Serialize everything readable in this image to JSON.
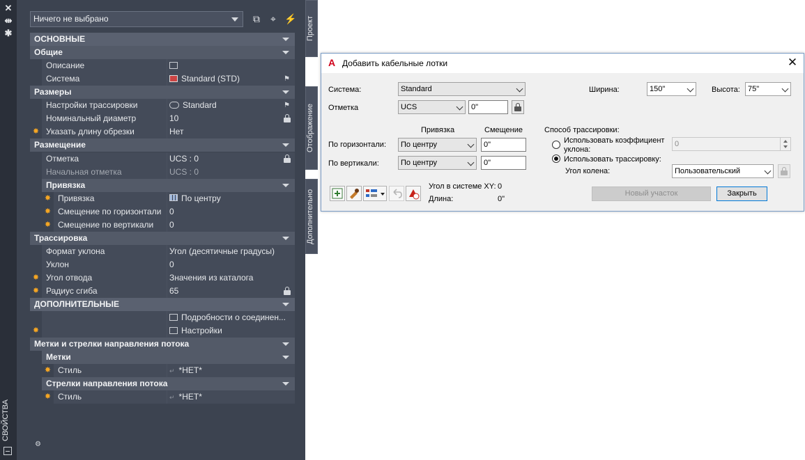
{
  "palette": {
    "title_vertical": "СВОЙСТВА",
    "selector_value": "Ничего не выбрано",
    "tabs": [
      "Проект",
      "Отображение",
      "Дополнительно"
    ],
    "rows": [
      {
        "type": "cat-top",
        "label": "ОСНОВНЫЕ"
      },
      {
        "type": "cat",
        "label": "Общие"
      },
      {
        "type": "prop",
        "label": "Описание",
        "value": "",
        "icon": "description-icon"
      },
      {
        "type": "prop",
        "label": "Система",
        "value": "Standard (STD)",
        "icon": "system-icon",
        "picker": true
      },
      {
        "type": "cat",
        "label": "Размеры"
      },
      {
        "type": "prop",
        "label": "Настройки трассировки",
        "value": "Standard",
        "icon": "routing-icon",
        "picker": true
      },
      {
        "type": "prop",
        "label": "Номинальный диаметр",
        "value": "10",
        "lock": true
      },
      {
        "type": "prop",
        "label": "Указать длину обрезки",
        "value": "Нет",
        "sun": true
      },
      {
        "type": "cat",
        "label": "Размещение"
      },
      {
        "type": "prop",
        "label": "Отметка",
        "value": "UCS : 0",
        "lock": true
      },
      {
        "type": "prop",
        "label": "Начальная отметка",
        "value": "UCS : 0",
        "dim": true
      },
      {
        "type": "subcat",
        "label": "Привязка"
      },
      {
        "type": "prop",
        "deep": true,
        "label": "Привязка",
        "value": "По центру",
        "icon": "anchor-grid-icon",
        "sun": true
      },
      {
        "type": "prop",
        "deep": true,
        "label": "Смещение по горизонтали",
        "value": "0",
        "sun": true
      },
      {
        "type": "prop",
        "deep": true,
        "label": "Смещение по вертикали",
        "value": "0",
        "sun": true
      },
      {
        "type": "cat",
        "label": "Трассировка"
      },
      {
        "type": "prop",
        "label": "Формат уклона",
        "value": "Угол (десятичные градусы)"
      },
      {
        "type": "prop",
        "label": "Уклон",
        "value": "0"
      },
      {
        "type": "prop",
        "label": "Угол отвода",
        "value": "Значения из каталога",
        "sun": true
      },
      {
        "type": "prop",
        "label": "Радиус сгиба",
        "value": "65",
        "sun": true,
        "lock": true
      },
      {
        "type": "cat-top",
        "label": "ДОПОЛНИТЕЛЬНЫЕ"
      },
      {
        "type": "prop",
        "label": "",
        "value": "Подробности о соединен...",
        "icon": "details-icon"
      },
      {
        "type": "prop",
        "label": "",
        "value": "Настройки",
        "icon": "settings-list-icon",
        "sun": true
      },
      {
        "type": "cat",
        "label": "Метки и стрелки направления потока"
      },
      {
        "type": "subcat",
        "label": "Метки"
      },
      {
        "type": "prop",
        "deep": true,
        "label": "Стиль",
        "value": "*НЕТ*",
        "sun": true,
        "glyph": true
      },
      {
        "type": "subcat",
        "label": "Стрелки направления потока"
      },
      {
        "type": "prop",
        "deep": true,
        "label": "Стиль",
        "value": "*НЕТ*",
        "sun": true,
        "glyph": true
      }
    ]
  },
  "dialog": {
    "title": "Добавить кабельные лотки",
    "system_label": "Система:",
    "system_value": "Standard",
    "elevation_label": "Отметка",
    "elevation_combo": "UCS",
    "elevation_value": "0\"",
    "width_label": "Ширина:",
    "width_value": "150\"",
    "height_label": "Высота:",
    "height_value": "75\"",
    "col_anchor": "Привязка",
    "col_offset": "Смещение",
    "horiz_label": "По горизонтали:",
    "horiz_anchor": "По центру",
    "horiz_offset": "0\"",
    "vert_label": "По вертикали:",
    "vert_anchor": "По центру",
    "vert_offset": "0\"",
    "routing_method_label": "Способ трассировки:",
    "use_slope_label_1": "Использовать коэффициент",
    "use_slope_label_2": "уклона:",
    "slope_value": "0",
    "use_routing_label": "Использовать трассировку:",
    "elbow_angle_label": "Угол колена:",
    "elbow_angle_value": "Пользовательский",
    "ucs_angle_label": "Угол в системе XY:",
    "ucs_angle_value": "0",
    "length_label": "Длина:",
    "length_value": "0\"",
    "new_segment_button": "Новый участок",
    "close_button": "Закрыть",
    "logo_letter": "A"
  },
  "colors": {
    "palette_bg": "#3c4350",
    "palette_titlebar": "#2a2f39",
    "category_bg": "#535a68",
    "accent_sun": "#f5a623",
    "dialog_bg": "#f0f0f0",
    "autodesk_red": "#d0021b",
    "focus_blue": "#0078d7"
  }
}
